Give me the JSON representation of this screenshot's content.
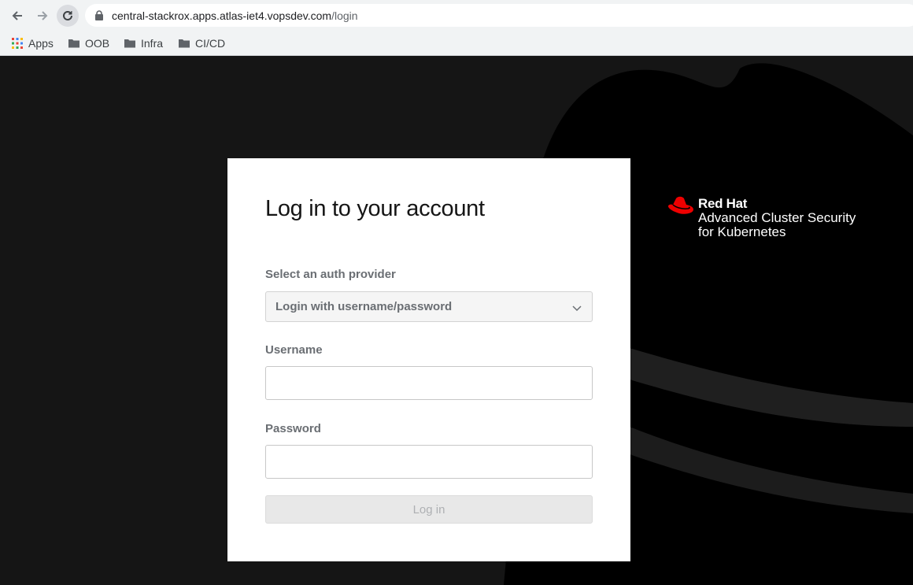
{
  "browser": {
    "url_host": "central-stackrox.apps.atlas-iet4.vopsdev.com",
    "url_path": "/login",
    "bookmarks": [
      {
        "label": "Apps",
        "icon": "apps-grid-icon"
      },
      {
        "label": "OOB",
        "icon": "folder-icon"
      },
      {
        "label": "Infra",
        "icon": "folder-icon"
      },
      {
        "label": "CI/CD",
        "icon": "folder-icon"
      }
    ]
  },
  "login": {
    "title": "Log in to your account",
    "provider_label": "Select an auth provider",
    "provider_value": "Login with username/password",
    "username_label": "Username",
    "username_value": "",
    "password_label": "Password",
    "password_value": "",
    "submit_label": "Log in"
  },
  "brand": {
    "company": "Red Hat",
    "product": "Advanced Cluster Security",
    "subtitle": "for Kubernetes",
    "accent_color": "#ee0000"
  }
}
